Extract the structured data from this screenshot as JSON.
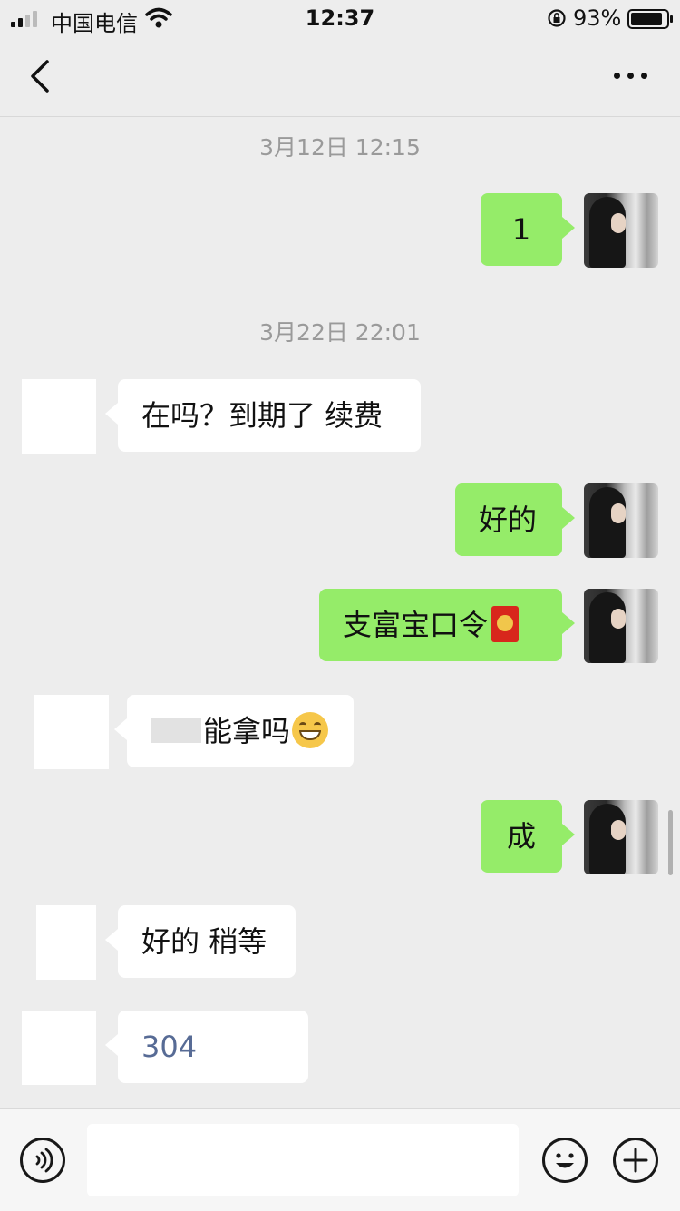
{
  "status_bar": {
    "carrier": "中国电信",
    "time": "12:37",
    "battery": "93%"
  },
  "navbar": {
    "back_icon": "chevron-left-icon",
    "more_icon": "more-dots-icon"
  },
  "timestamps": [
    "3月12日 12:15",
    "3月22日 22:01"
  ],
  "messages": [
    {
      "side": "me",
      "text": "1"
    },
    {
      "side": "them",
      "text": "在吗？到期了 续费"
    },
    {
      "side": "me",
      "text": "好的"
    },
    {
      "side": "me",
      "text": "支富宝口令",
      "icon": "red-envelope-icon"
    },
    {
      "side": "them",
      "text": "能拿吗",
      "icon": "grinning-face-icon"
    },
    {
      "side": "me",
      "text": "成"
    },
    {
      "side": "them",
      "text": "好的 稍等"
    },
    {
      "side": "them",
      "text": "304"
    }
  ],
  "input_bar": {
    "voice_icon": "voice-icon",
    "emoji_icon": "emoji-icon",
    "plus_icon": "plus-icon",
    "message_value": ""
  }
}
